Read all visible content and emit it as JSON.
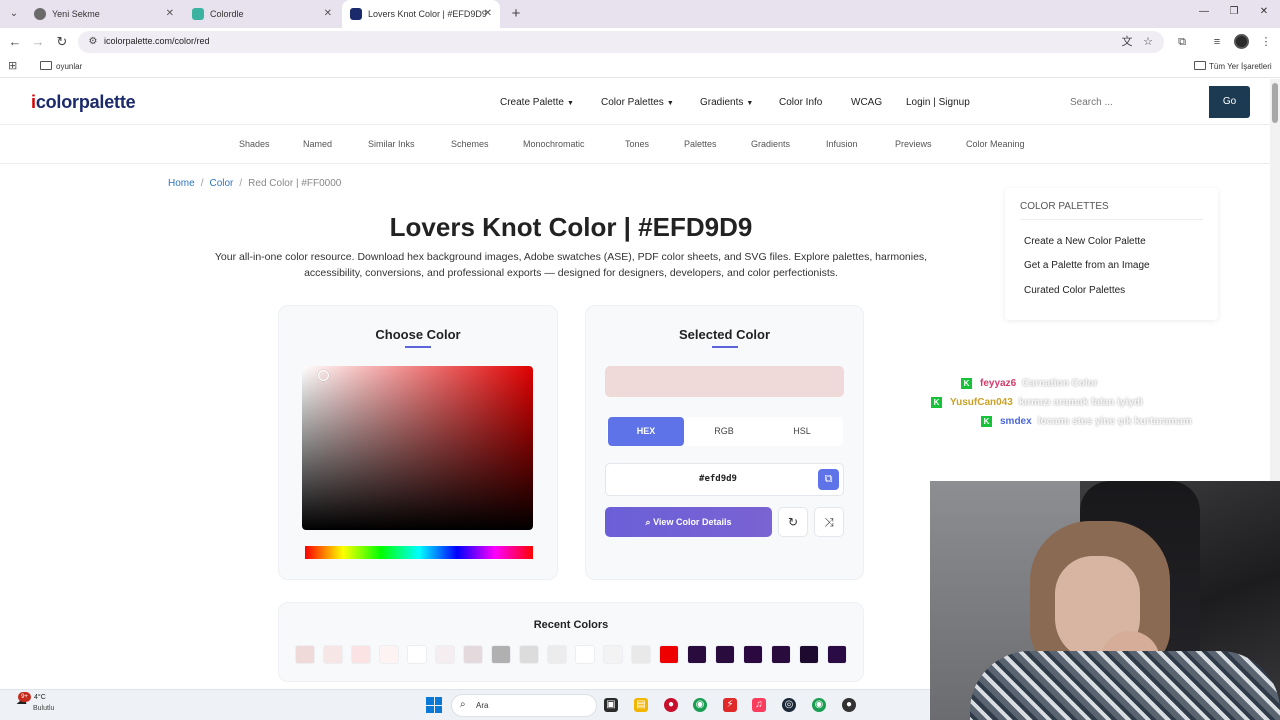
{
  "browser": {
    "tabs": [
      {
        "title": "Yeni Sekme",
        "active": false
      },
      {
        "title": "Colordle",
        "active": false
      },
      {
        "title": "Lovers Knot Color | #EFD9D9",
        "active": true
      }
    ],
    "url": "icolorpalette.com/color/red",
    "bookmarks": {
      "folder": "oyunlar",
      "all_bookmarks": "Tüm Yer İşaretleri"
    }
  },
  "site": {
    "logo_i": "i",
    "logo_rest": "colorpalette",
    "nav": [
      {
        "label": "Create Palette",
        "dropdown": true
      },
      {
        "label": "Color Palettes",
        "dropdown": true
      },
      {
        "label": "Gradients",
        "dropdown": true
      },
      {
        "label": "Color Info",
        "dropdown": false
      },
      {
        "label": "WCAG",
        "dropdown": false
      },
      {
        "label": "Login | Signup",
        "dropdown": false
      }
    ],
    "search_placeholder": "Search ...",
    "search_button": "Go",
    "subnav": [
      "Shades",
      "Named",
      "Similar Inks",
      "Schemes",
      "Monochromatic",
      "Tones",
      "Palettes",
      "Gradients",
      "Infusion",
      "Previews",
      "Color Meaning"
    ]
  },
  "breadcrumb": {
    "home": "Home",
    "color": "Color",
    "current": "Red Color | #FF0000"
  },
  "page": {
    "title": "Lovers Knot Color | #EFD9D9",
    "description": "Your all-in-one color resource. Download hex background images, Adobe swatches (ASE), PDF color sheets, and SVG files. Explore palettes, harmonies, accessibility, conversions, and professional exports — designed for designers, developers, and color perfectionists."
  },
  "chooser": {
    "title": "Choose Color"
  },
  "selected": {
    "title": "Selected Color",
    "preview_color": "#efd9d9",
    "modes": [
      "HEX",
      "RGB",
      "HSL"
    ],
    "active_mode": "HEX",
    "hex_value": "#efd9d9",
    "view_details_label": "View Color Details"
  },
  "recent": {
    "title": "Recent Colors",
    "colors": [
      "#efd9d9",
      "#f7e6e6",
      "#fbe3e3",
      "#fcf3f2",
      "#ffffff",
      "#f5eef0",
      "#e4d9dc",
      "#b0b0b0",
      "#dcdcdc",
      "#ececec",
      "#ffffff",
      "#f3f3f3",
      "#e9e9e9",
      "#ee0000",
      "#2a0b3e",
      "#2a0b3e",
      "#2b0840",
      "#2a0b3e",
      "#1e0a2e",
      "#2b0b44"
    ]
  },
  "sidebar": {
    "heading": "COLOR PALETTES",
    "links": [
      "Create a New Color Palette",
      "Get a Palette from an Image",
      "Curated Color Palettes"
    ]
  },
  "chat": [
    {
      "user": "feyyaz6",
      "user_color": "#d23b6b",
      "message": "Carnation Color"
    },
    {
      "user": "YusufCan043",
      "user_color": "#c9a227",
      "message": "kırmızı aramak falan iyiydi"
    },
    {
      "user": "smdex",
      "user_color": "#4a68d6",
      "message": "locamı stes yine çık kurtaramam"
    }
  ],
  "taskbar": {
    "weather_badge": "9+",
    "temperature": "4°C",
    "weather": "Bulutlu",
    "search_placeholder": "Ara"
  }
}
